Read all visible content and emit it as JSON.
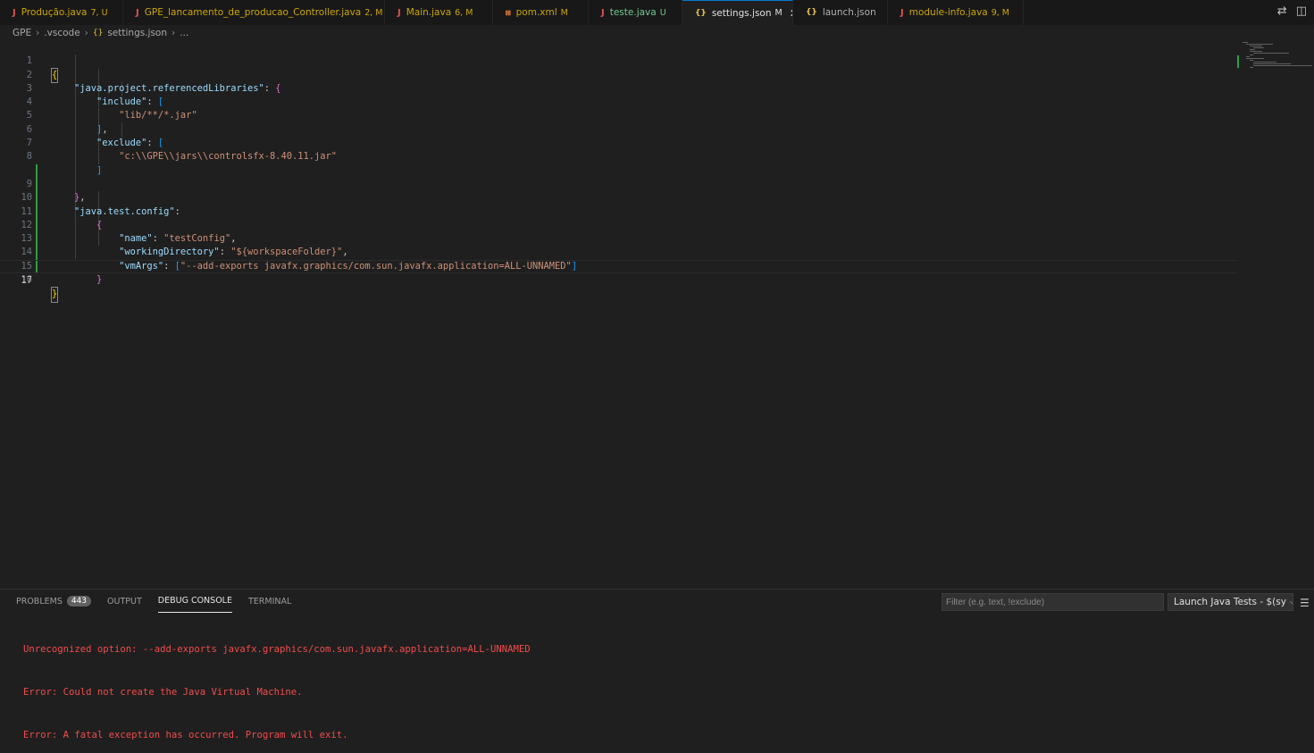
{
  "tabs": [
    {
      "name": "Produção.java",
      "status": "7, U",
      "icon": "J",
      "type": "java",
      "state": "untracked-mod"
    },
    {
      "name": "GPE_lancamento_de_producao_Controller.java",
      "status": "2, M",
      "icon": "J",
      "type": "java"
    },
    {
      "name": "Main.java",
      "status": "6, M",
      "icon": "J",
      "type": "java"
    },
    {
      "name": "pom.xml",
      "status": "M",
      "icon": "rss",
      "type": "xml"
    },
    {
      "name": "teste.java",
      "status": "U",
      "icon": "J",
      "type": "java",
      "state": "untracked"
    },
    {
      "name": "settings.json",
      "status": "M",
      "icon": "{}",
      "type": "json",
      "active": true
    },
    {
      "name": "launch.json",
      "status": "",
      "icon": "{}",
      "type": "json",
      "state": "plain"
    },
    {
      "name": "module-info.java",
      "status": "9, M",
      "icon": "J",
      "type": "java"
    }
  ],
  "tab_close_glyph": "✕",
  "breadcrumb": {
    "root": "GPE",
    "folder": ".vscode",
    "file": "settings.json",
    "more": "..."
  },
  "editor": {
    "line_numbers": [
      "1",
      "2",
      "3",
      "4",
      "5",
      "6",
      "7",
      "8",
      "9",
      "10",
      "11",
      "12",
      "13",
      "14",
      "15",
      "16",
      "17"
    ],
    "active_line": "17"
  },
  "panel": {
    "tabs": {
      "problems": "Problems",
      "problems_count": "443",
      "output": "Output",
      "debug_console": "Debug Console",
      "terminal": "Terminal"
    },
    "filter_placeholder": "Filter (e.g. text, !exclude)",
    "launch_config": "Launch Java Tests - $(sy",
    "console_lines": [
      "Unrecognized option: --add-exports javafx.graphics/com.sun.javafx.application=ALL-UNNAMED",
      "Error: Could not create the Java Virtual Machine.",
      "Error: A fatal exception has occurred. Program will exit."
    ]
  },
  "colors": {
    "accent": "#0078d4",
    "modified": "#cca700",
    "untracked": "#73c991",
    "error": "#f14c4c",
    "json_key": "#9cdcfe",
    "json_string": "#ce9178"
  },
  "icons": {
    "java_file": "java-file-icon",
    "xml_file": "xml-file-icon",
    "json_file": "json-file-icon",
    "compare": "compare-changes-icon",
    "split": "split-editor-icon",
    "menu": "panel-menu-icon",
    "chevron": "chevron-down-icon"
  }
}
